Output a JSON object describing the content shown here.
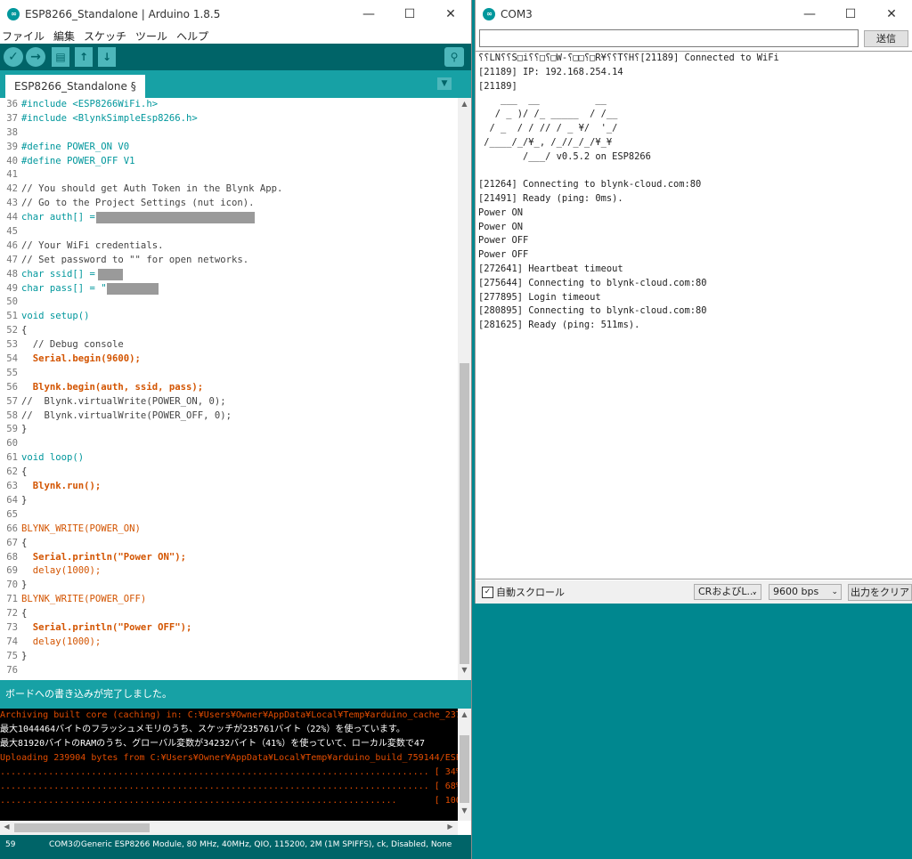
{
  "ide": {
    "title": "ESP8266_Standalone | Arduino 1.8.5",
    "menu": [
      "ファイル",
      "編集",
      "スケッチ",
      "ツール",
      "ヘルプ"
    ],
    "tab": "ESP8266_Standalone §",
    "status": "ボードへの書き込みが完了しました。",
    "bottom_line": "59",
    "bottom_board": "COM3のGeneric ESP8266 Module, 80 MHz, 40MHz, QIO, 115200, 2M (1M SPIFFS), ck, Disabled, None",
    "code": [
      {
        "n": "36",
        "t": "#include <ESP8266WiFi.h>"
      },
      {
        "n": "37",
        "t": "#include <BlynkSimpleEsp8266.h>"
      },
      {
        "n": "38",
        "t": ""
      },
      {
        "n": "39",
        "t": "#define POWER_ON V0"
      },
      {
        "n": "40",
        "t": "#define POWER_OFF V1"
      },
      {
        "n": "41",
        "t": ""
      },
      {
        "n": "42",
        "t": "// You should get Auth Token in the Blynk App."
      },
      {
        "n": "43",
        "t": "// Go to the Project Settings (nut icon)."
      },
      {
        "n": "44",
        "t": "char auth[] = \"\";"
      },
      {
        "n": "45",
        "t": ""
      },
      {
        "n": "46",
        "t": "// Your WiFi credentials."
      },
      {
        "n": "47",
        "t": "// Set password to \"\" for open networks."
      },
      {
        "n": "48",
        "t": "char ssid[] = \"\";"
      },
      {
        "n": "49",
        "t": "char pass[] = \"\";"
      },
      {
        "n": "50",
        "t": ""
      },
      {
        "n": "51",
        "t": "void setup()"
      },
      {
        "n": "52",
        "t": "{"
      },
      {
        "n": "53",
        "t": "  // Debug console"
      },
      {
        "n": "54",
        "t": "  Serial.begin(9600);"
      },
      {
        "n": "55",
        "t": ""
      },
      {
        "n": "56",
        "t": "  Blynk.begin(auth, ssid, pass);"
      },
      {
        "n": "57",
        "t": "//  Blynk.virtualWrite(POWER_ON, 0);"
      },
      {
        "n": "58",
        "t": "//  Blynk.virtualWrite(POWER_OFF, 0);"
      },
      {
        "n": "59",
        "t": "}"
      },
      {
        "n": "60",
        "t": ""
      },
      {
        "n": "61",
        "t": "void loop()"
      },
      {
        "n": "62",
        "t": "{"
      },
      {
        "n": "63",
        "t": "  Blynk.run();"
      },
      {
        "n": "64",
        "t": "}"
      },
      {
        "n": "65",
        "t": ""
      },
      {
        "n": "66",
        "t": "BLYNK_WRITE(POWER_ON)"
      },
      {
        "n": "67",
        "t": "{"
      },
      {
        "n": "68",
        "t": "  Serial.println(\"Power ON\");"
      },
      {
        "n": "69",
        "t": "  delay(1000);"
      },
      {
        "n": "70",
        "t": "}"
      },
      {
        "n": "71",
        "t": "BLYNK_WRITE(POWER_OFF)"
      },
      {
        "n": "72",
        "t": "{"
      },
      {
        "n": "73",
        "t": "  Serial.println(\"Power OFF\");"
      },
      {
        "n": "74",
        "t": "  delay(1000);"
      },
      {
        "n": "75",
        "t": "}"
      },
      {
        "n": "76",
        "t": ""
      }
    ],
    "console": [
      {
        "c": "orange",
        "t": "Archiving built core (caching) in: C:¥Users¥Owner¥AppData¥Local¥Temp¥arduino_cache_237165¥core"
      },
      {
        "c": "white",
        "t": "最大1044464バイトのフラッシュメモリのうち、スケッチが235761バイト（22%）を使っています。"
      },
      {
        "c": "white",
        "t": "最大81920バイトのRAMのうち、グローバル変数が34232バイト（41%）を使っていて、ローカル変数で47"
      },
      {
        "c": "orange",
        "t": "Uploading 239904 bytes from C:¥Users¥Owner¥AppData¥Local¥Temp¥arduino_build_759144/ESP8266_St"
      },
      {
        "c": "orange",
        "t": "................................................................................ [ 34% ]"
      },
      {
        "c": "orange",
        "t": "................................................................................ [ 68% ]"
      },
      {
        "c": "orange",
        "t": "..........................................................................       [ 100% ]"
      }
    ]
  },
  "monitor": {
    "title": "COM3",
    "send_label": "送信",
    "send_value": "",
    "autoscroll_label": "自動スクロール",
    "line_ending": "CRおよびL...",
    "baud": "9600 bps",
    "clear_label": "出力をクリア",
    "lines": [
      "⸮⸮LN⸮⸮S□i⸮⸮□⸮□W-⸮□□⸮□R¥⸮⸮T⸮H⸮[21189] Connected to WiFi",
      "[21189] IP: 192.168.254.14",
      "[21189]",
      "    ___  __          __",
      "   / _ )/ /_ _____  / /__",
      "  / _  / / // / _ ¥/  '_/",
      " /____/_/¥_, /_//_/_/¥_¥",
      "        /___/ v0.5.2 on ESP8266",
      "",
      "[21264] Connecting to blynk-cloud.com:80",
      "[21491] Ready (ping: 0ms).",
      "Power ON",
      "Power ON",
      "Power OFF",
      "Power OFF",
      "[272641] Heartbeat timeout",
      "[275644] Connecting to blynk-cloud.com:80",
      "[277895] Login timeout",
      "[280895] Connecting to blynk-cloud.com:80",
      "[281625] Ready (ping: 511ms)."
    ]
  },
  "window_controls": {
    "minimize": "—",
    "maximize": "☐",
    "close": "✕"
  }
}
